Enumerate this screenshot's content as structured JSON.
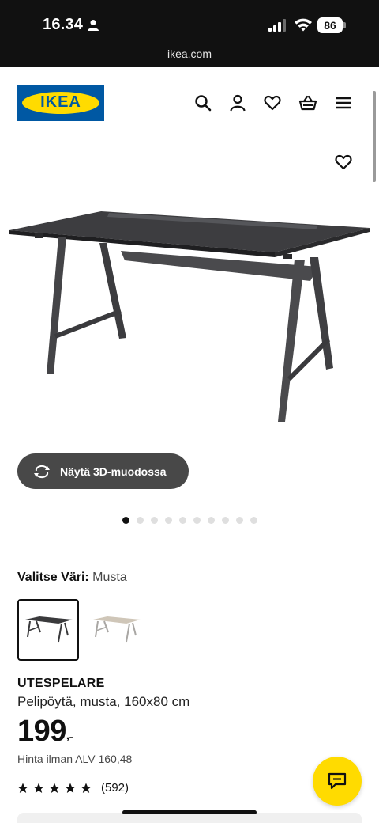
{
  "status_bar": {
    "time": "16.34",
    "battery": "86",
    "url": "ikea.com"
  },
  "header": {
    "logo_text": "IKEA",
    "icons": [
      "search-icon",
      "account-icon",
      "favourites-icon",
      "basket-icon",
      "menu-icon"
    ]
  },
  "gallery": {
    "view_3d_label": "Näytä 3D-muodossa",
    "image_count": 10,
    "active_index": 0
  },
  "product": {
    "color_label": "Valitse Väri:",
    "color_value": "Musta",
    "name": "UTESPELARE",
    "description": "Pelipöytä, musta,",
    "size_link": "160x80 cm",
    "price_main": "199",
    "price_suffix": ",",
    "price_dash": "-",
    "vat_text": "Hinta ilman ALV 160,48",
    "rating_stars": 5,
    "rating_count": "(592)"
  },
  "colors": {
    "brand_blue": "#0058a3",
    "brand_yellow": "#ffdb00",
    "dark_button": "#484848"
  }
}
